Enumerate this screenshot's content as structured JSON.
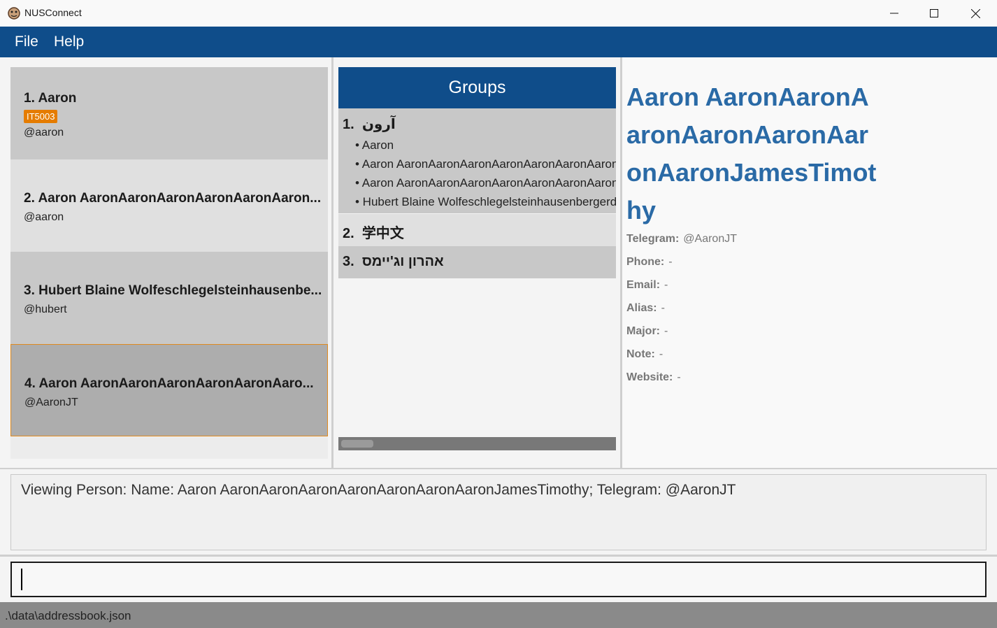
{
  "window": {
    "title": "NUSConnect",
    "icon": "app-icon",
    "controls": [
      "minimize-icon",
      "maximize-icon",
      "close-icon"
    ]
  },
  "menu": {
    "items": [
      {
        "label": "File"
      },
      {
        "label": "Help"
      }
    ]
  },
  "persons": [
    {
      "index": "1.",
      "name": "Aaron",
      "tag": "IT5003",
      "handle": "@aaron"
    },
    {
      "index": "2.",
      "name": "Aaron AaronAaronAaronAaronAaronAaron...",
      "handle": "@aaron"
    },
    {
      "index": "3.",
      "name": "Hubert Blaine Wolfeschlegelsteinhausenbe...",
      "handle": "@hubert"
    },
    {
      "index": "4.",
      "name": "Aaron AaronAaronAaronAaronAaronAaro...",
      "handle": "@AaronJT",
      "selected": true
    }
  ],
  "groups": {
    "header": "Groups",
    "list": [
      {
        "index": "1.",
        "name": "آرون",
        "members": [
          "• Aaron",
          "• Aaron AaronAaronAaronAaronAaronAaronAaronJamesTimothy",
          "• Aaron AaronAaronAaronAaronAaronAaronAaronJamesTimothy",
          "• Hubert Blaine Wolfeschlegelsteinhausenbergerdorff"
        ]
      },
      {
        "index": "2.",
        "name": "学中文",
        "members": []
      },
      {
        "index": "3.",
        "name": "אהרון וג'יימס",
        "members": []
      }
    ]
  },
  "details": {
    "name": "Aaron AaronAaronAaronAaronAaronAaronAaronJamesTimothy",
    "fields": [
      {
        "label": "Telegram:",
        "value": "@AaronJT"
      },
      {
        "label": "Phone:",
        "value": "-"
      },
      {
        "label": "Email:",
        "value": "-"
      },
      {
        "label": "Alias:",
        "value": "-"
      },
      {
        "label": "Major:",
        "value": "-"
      },
      {
        "label": "Note:",
        "value": "-"
      },
      {
        "label": "Website:",
        "value": "-"
      }
    ]
  },
  "result": {
    "text": "Viewing Person: Name: Aaron AaronAaronAaronAaronAaronAaronAaronJamesTimothy; Telegram: @AaronJT"
  },
  "command": {
    "value": ""
  },
  "status": {
    "path": ".\\data\\addressbook.json"
  },
  "colors": {
    "menubar": "#0f4d8a",
    "accent_name": "#2a6aa6",
    "tag": "#e57c00",
    "selected_border": "#e08a1e"
  }
}
